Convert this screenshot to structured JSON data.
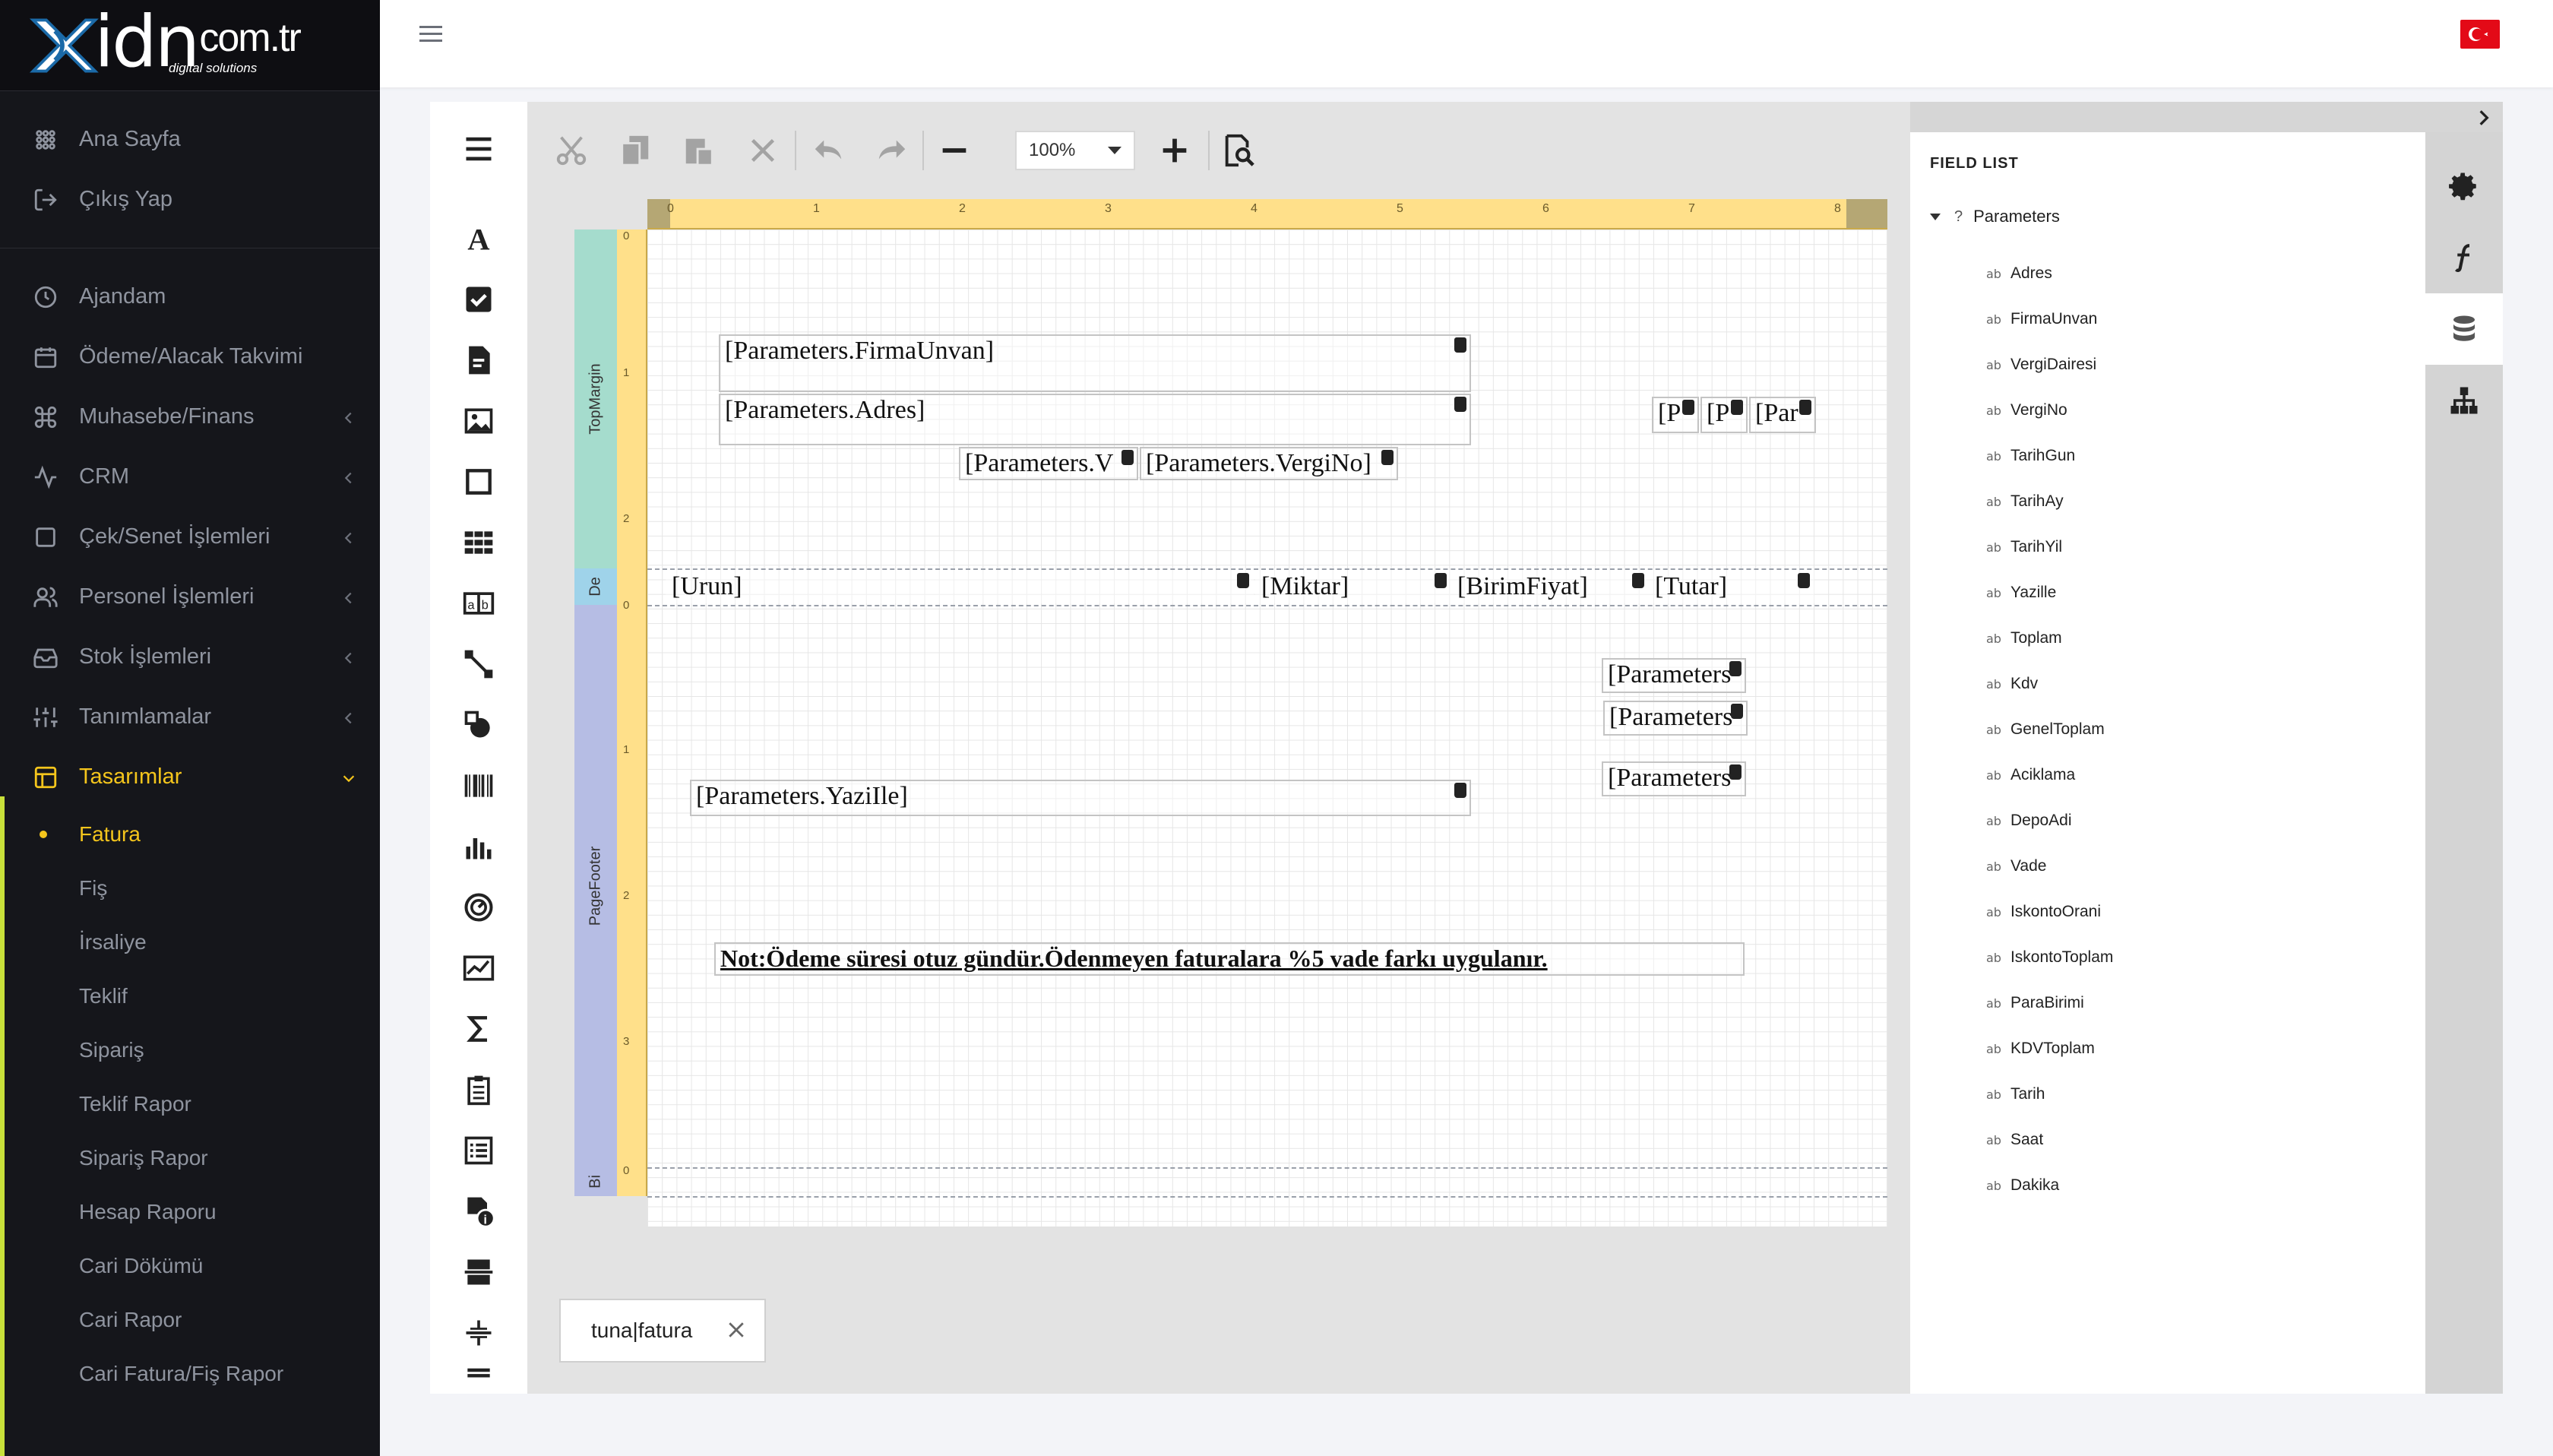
{
  "brand": {
    "name": "idn",
    "tld": "com.tr",
    "tagline": "digital solutions"
  },
  "sidebar": {
    "top_items": [
      {
        "label": "Ana Sayfa",
        "icon": "grid-icon"
      },
      {
        "label": "Çıkış Yap",
        "icon": "logout-icon"
      }
    ],
    "items": [
      {
        "label": "Ajandam",
        "icon": "clock-icon",
        "expandable": false
      },
      {
        "label": "Ödeme/Alacak Takvimi",
        "icon": "calendar-icon",
        "expandable": false
      },
      {
        "label": "Muhasebe/Finans",
        "icon": "command-icon",
        "expandable": true
      },
      {
        "label": "CRM",
        "icon": "activity-icon",
        "expandable": true
      },
      {
        "label": "Çek/Senet İşlemleri",
        "icon": "square-icon",
        "expandable": true
      },
      {
        "label": "Personel İşlemleri",
        "icon": "users-icon",
        "expandable": true
      },
      {
        "label": "Stok İşlemleri",
        "icon": "inbox-icon",
        "expandable": true
      },
      {
        "label": "Tanımlamalar",
        "icon": "sliders-icon",
        "expandable": true
      },
      {
        "label": "Tasarımlar",
        "icon": "layout-icon",
        "expandable": true,
        "active": true
      }
    ],
    "subitems": [
      {
        "label": "Fatura",
        "active": true
      },
      {
        "label": "Fiş"
      },
      {
        "label": "İrsaliye"
      },
      {
        "label": "Teklif"
      },
      {
        "label": "Sipariş"
      },
      {
        "label": "Teklif Rapor"
      },
      {
        "label": "Sipariş Rapor"
      },
      {
        "label": "Hesap Raporu"
      },
      {
        "label": "Cari Dökümü"
      },
      {
        "label": "Cari Rapor"
      },
      {
        "label": "Cari Fatura/Fiş Rapor"
      }
    ]
  },
  "toolbar": {
    "zoom": "100%"
  },
  "ruler": {
    "ticks": [
      "0",
      "1",
      "2",
      "3",
      "4",
      "5",
      "6",
      "7",
      "8"
    ]
  },
  "bands": {
    "top": "TopMargin",
    "detail": "De",
    "footer": "PageFooter",
    "bottom": "Bi"
  },
  "vruler": {
    "top": [
      "0",
      "1",
      "2"
    ],
    "footer": [
      "0",
      "1",
      "2",
      "3",
      "0"
    ]
  },
  "report_controls": {
    "firma": "[Parameters.FirmaUnvan]",
    "adres": "[Parameters.Adres]",
    "vergidairesi": "[Parameters.V",
    "vergino": "[Parameters.VergiNo]",
    "p1": "[P",
    "p2": "[P",
    "p3": "[Par",
    "urun": "[Urun]",
    "miktar": "[Miktar]",
    "birimfiyat": "[BirimFiyat]",
    "tutar": "[Tutar]",
    "toplam": "[Parameters",
    "kdv": "[Parameters",
    "genel": "[Parameters",
    "yazile": "[Parameters.YaziIle]",
    "note": "Not:Ödeme süresi otuz gündür.Ödenmeyen faturalara %5 vade farkı uygulanır."
  },
  "report_tab": {
    "name": "tuna|fatura"
  },
  "field_list": {
    "title": "FIELD LIST",
    "root": "Parameters",
    "fields": [
      "Adres",
      "FirmaUnvan",
      "VergiDairesi",
      "VergiNo",
      "TarihGun",
      "TarihAy",
      "TarihYil",
      "Yazille",
      "Toplam",
      "Kdv",
      "GenelToplam",
      "Aciklama",
      "DepoAdi",
      "Vade",
      "IskontoOrani",
      "IskontoToplam",
      "ParaBirimi",
      "KDVToplam",
      "Tarih",
      "Saat",
      "Dakika"
    ]
  },
  "colors": {
    "sidebar_bg": "#15161b",
    "accent": "#f4c51c",
    "active_bar": "#c8e03a",
    "ruler": "#ffe08a",
    "band_top": "#a5dccd",
    "band_detail": "#9fd3ea",
    "band_footer": "#b6bde4",
    "flag": "#e30a17"
  }
}
